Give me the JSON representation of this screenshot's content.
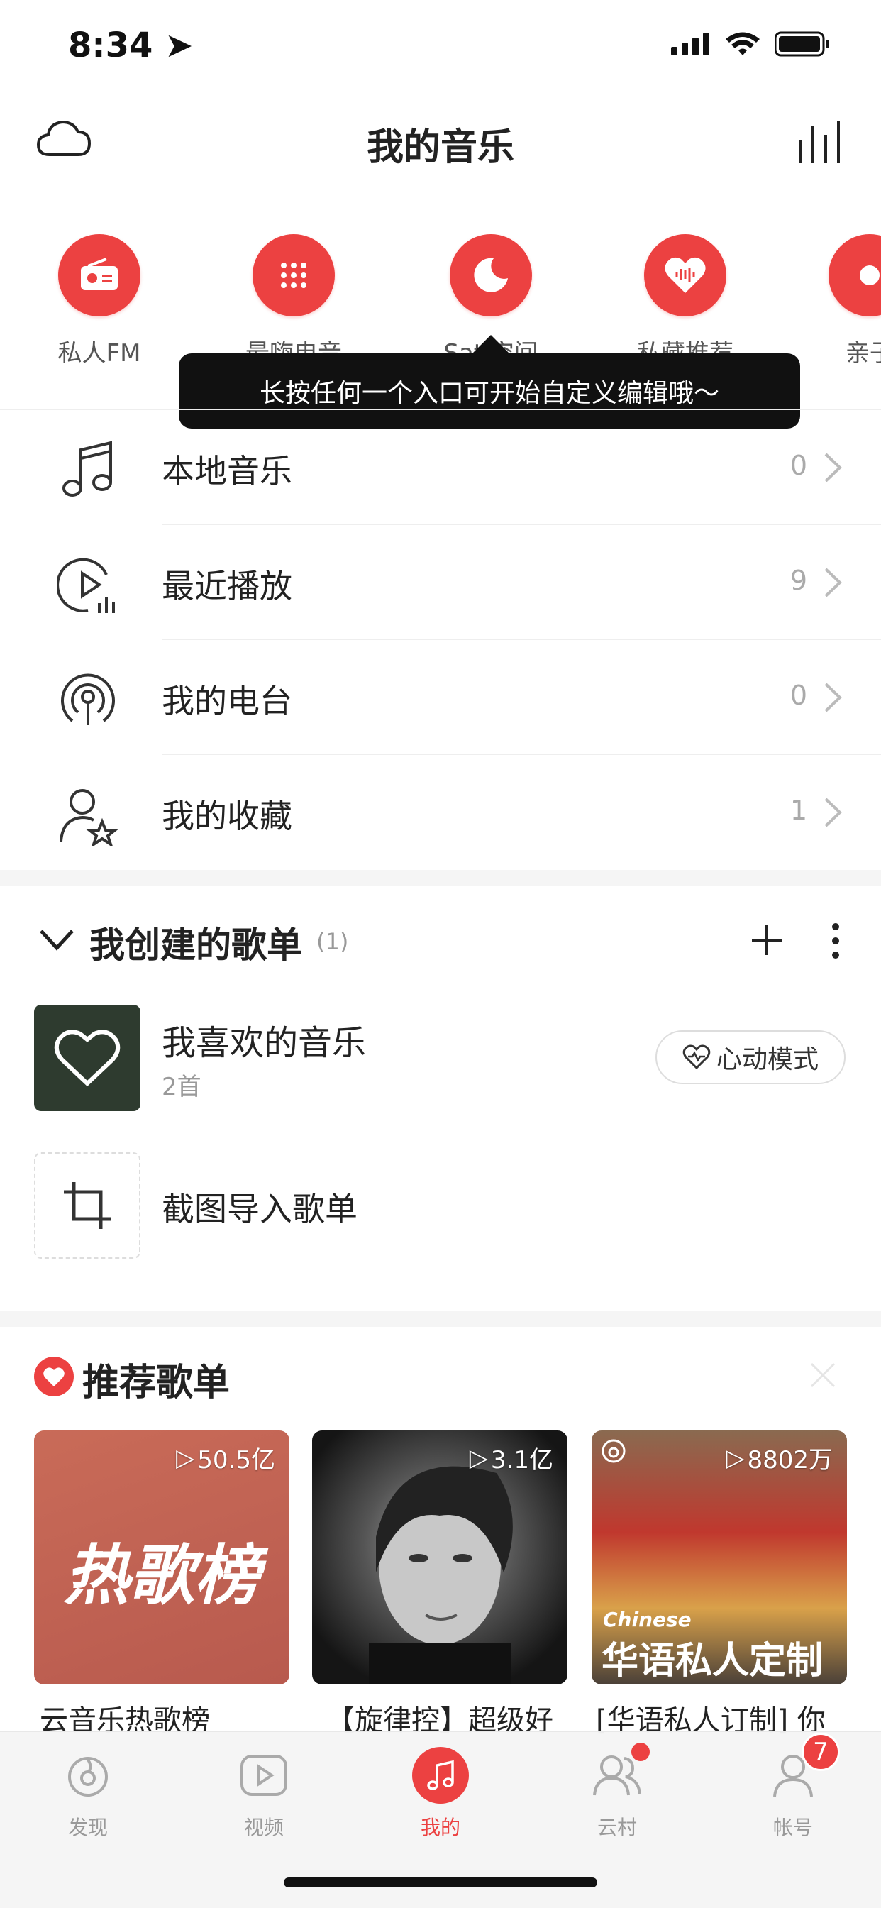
{
  "status": {
    "time": "8:34"
  },
  "header": {
    "title": "我的音乐"
  },
  "entries": [
    {
      "label": "私人FM",
      "icon": "radio-icon"
    },
    {
      "label": "最嗨电音",
      "icon": "dots-grid-icon"
    },
    {
      "label": "Sati空间",
      "icon": "moon-icon"
    },
    {
      "label": "私藏推荐",
      "icon": "heart-wave-icon"
    },
    {
      "label": "亲子",
      "icon": "kids-icon"
    }
  ],
  "tooltip": {
    "text": "长按任何一个入口可开始自定义编辑哦～"
  },
  "list": [
    {
      "label": "本地音乐",
      "count": "0",
      "icon": "music-note-icon"
    },
    {
      "label": "最近播放",
      "count": "9",
      "icon": "recent-play-icon"
    },
    {
      "label": "我的电台",
      "count": "0",
      "icon": "podcast-icon"
    },
    {
      "label": "我的收藏",
      "count": "1",
      "icon": "user-star-icon"
    }
  ],
  "playlists": {
    "title": "我创建的歌单",
    "count": "(1)",
    "items": [
      {
        "title": "我喜欢的音乐",
        "subtitle": "2首",
        "button": "心动模式"
      }
    ],
    "import_label": "截图导入歌单"
  },
  "recommend": {
    "title": "推荐歌单",
    "cards": [
      {
        "label": "云音乐热歌榜",
        "plays": "50.5亿",
        "cover_text": "热歌榜"
      },
      {
        "label": "【旋律控】超级好",
        "plays": "3.1亿",
        "cover_text": ""
      },
      {
        "label": "[华语私人订制] 你",
        "plays": "8802万",
        "cover_text": "华语私人定制",
        "cover_small": "Chinese"
      }
    ]
  },
  "tabs": [
    {
      "label": "发现",
      "icon": "discover-icon"
    },
    {
      "label": "视频",
      "icon": "video-icon"
    },
    {
      "label": "我的",
      "icon": "my-music-icon",
      "active": true
    },
    {
      "label": "云村",
      "icon": "community-icon"
    },
    {
      "label": "帐号",
      "icon": "account-icon",
      "badge": "7"
    }
  ],
  "colors": {
    "accent": "#ec4141"
  }
}
